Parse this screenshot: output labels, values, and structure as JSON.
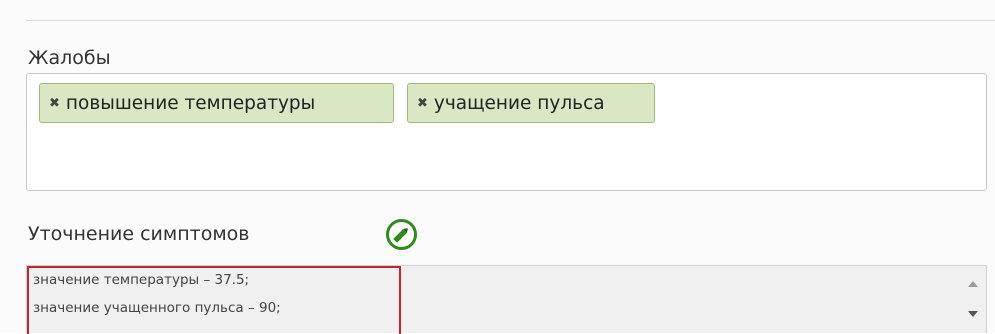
{
  "complaints": {
    "label": "Жалобы",
    "tags": [
      {
        "remove_icon": "✖",
        "text": "повышение температуры"
      },
      {
        "remove_icon": "✖",
        "text": "учащение пульса"
      }
    ]
  },
  "symptoms": {
    "label": "Уточнение симптомов",
    "edit_icon": "pencil-in-circle",
    "lines": [
      "значение температуры – 37.5;",
      "значение учащенного пульса – 90;"
    ],
    "highlight_color": "#c0272d"
  },
  "colors": {
    "tag_background": "#d9e7c4",
    "tag_border": "#9cbb79",
    "edit_icon_green": "#2e8b1e"
  }
}
